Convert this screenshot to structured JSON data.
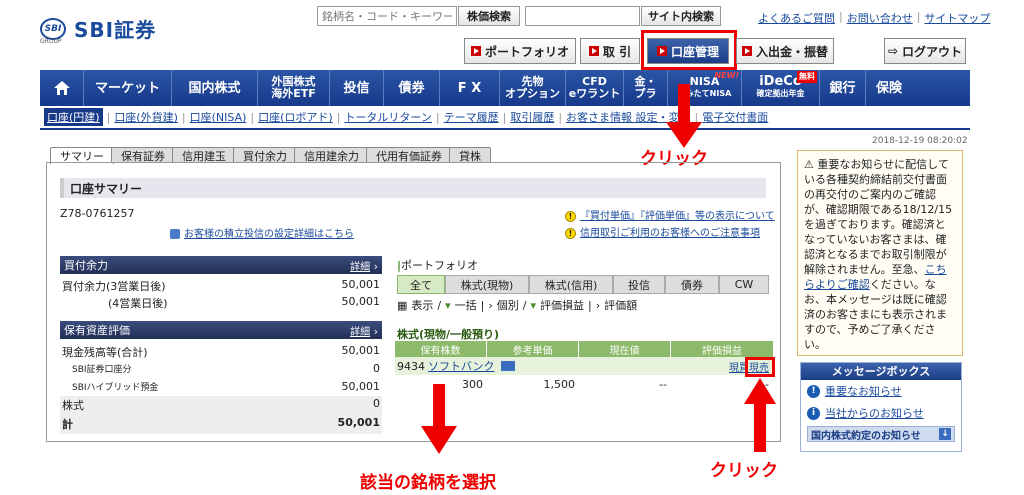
{
  "header": {
    "logo_mark": "SBI",
    "logo_sub": "GROUP",
    "logo_text": "SBI証券",
    "search_placeholder": "銘柄名・コード・キーワード",
    "stock_search_btn": "株価検索",
    "site_search_btn": "サイト内検索",
    "links": [
      "よくあるご質問",
      "お問い合わせ",
      "サイトマップ"
    ],
    "buttons": [
      "ポートフォリオ",
      "取 引",
      "口座管理",
      "入出金・振替"
    ],
    "logout": "ログアウト"
  },
  "nav": {
    "items": [
      {
        "label": "マーケット"
      },
      {
        "label": "国内株式"
      },
      {
        "label": "外国株式",
        "sub": "海外ETF"
      },
      {
        "label": "投信"
      },
      {
        "label": "債券"
      },
      {
        "label": "F X"
      },
      {
        "label": "先物",
        "sub": "オプション"
      },
      {
        "label": "CFD",
        "sub": "eワラント"
      },
      {
        "label": "金・",
        "sub": "プラ"
      },
      {
        "label": "NISA",
        "sub": "つみたてNISA",
        "new": "NEW!"
      },
      {
        "label": "iDeCo",
        "sub": "確定拠出年金",
        "badge": "無料"
      },
      {
        "label": "銀行"
      },
      {
        "label": "保険"
      }
    ]
  },
  "subnav": [
    "口座(円建)",
    "口座(外貨建)",
    "口座(NISA)",
    "口座(ロボアド)",
    "トータルリターン",
    "テーマ履歴",
    "取引履歴",
    "お客さま情報 設定・変更",
    "電子交付書面"
  ],
  "timestamp": "2018-12-19 08:20:02",
  "annotations": {
    "click_top": "クリック",
    "select_stock": "該当の銘柄を選択",
    "click_bottom": "クリック"
  },
  "tabs": [
    "サマリー",
    "保有証券",
    "信用建玉",
    "買付余力",
    "信用建余力",
    "代用有価証券",
    "貸株"
  ],
  "summary": {
    "title": "口座サマリー",
    "account": "Z78-0761257",
    "link_reserve": "お客様の積立投信の設定詳細はこちら",
    "notice1": "『買付単価』『評価単価』等の表示について",
    "notice2": "信用取引ご利用のお客様へのご注意事項"
  },
  "buying_power": {
    "title": "買付余力",
    "detail": "詳細",
    "rows": [
      {
        "label": "買付余力(3営業日後)",
        "value": "50,001"
      },
      {
        "label": "(4営業日後)",
        "value": "50,001"
      }
    ]
  },
  "assets": {
    "title": "保有資産評価",
    "detail": "詳細",
    "rows": [
      {
        "label": "現金残高等(合計)",
        "value": "50,001"
      },
      {
        "label": "SBI証券口座分",
        "value": "0"
      },
      {
        "label": "SBIハイブリッド預金",
        "value": "50,001"
      },
      {
        "label": "株式",
        "value": "0"
      },
      {
        "label": "計",
        "value": "50,001"
      }
    ]
  },
  "portfolio": {
    "label": "ポートフォリオ",
    "tabs": [
      "全て",
      "株式(現物)",
      "株式(信用)",
      "投信",
      "債券",
      "CW"
    ],
    "opts": [
      "表示",
      "一括",
      "個別",
      "評価損益",
      "評価額"
    ],
    "section": "株式(現物/一般預り)",
    "headers": [
      "保有株数",
      "参考単価",
      "現在値",
      "評価損益"
    ],
    "stock_code": "9434",
    "stock_name": "ソフトバンク",
    "actions": [
      "現買",
      "現売"
    ],
    "qty": "300",
    "unit_price": "1,500",
    "current": "--",
    "pl": "--"
  },
  "notice": {
    "text": "重要なお知らせに配信している各種契約締結前交付書面の再交付のご案内のご確認が、確認期限である18/12/15を過ぎております。確認済となっていないお客さまは、確認済となるまでお取引制限が解除されません。至急、",
    "link": "こちらよりご確認",
    "text2": "ください。なお、本メッセージは既に確認済のお客さまにも表示されますので、予めご了承ください。"
  },
  "messages": {
    "title": "メッセージボックス",
    "items": [
      "重要なお知らせ",
      "当社からのお知らせ"
    ],
    "footer": "国内株式約定のお知らせ"
  }
}
